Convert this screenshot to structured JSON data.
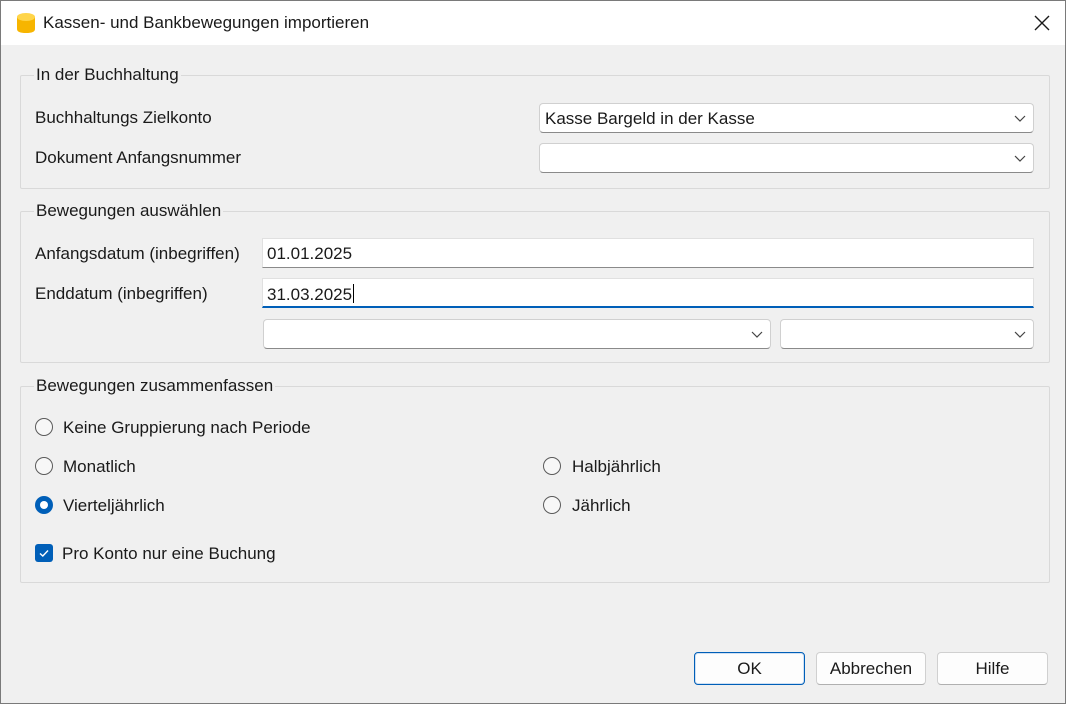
{
  "window": {
    "title": "Kassen- und Bankbewegungen importieren",
    "accent": "#005fb8"
  },
  "icons": {
    "app": "database-icon",
    "close": "close-icon",
    "dropdown": "chevron-down-icon",
    "check": "checkmark-icon"
  },
  "accounting": {
    "group_title": "In der Buchhaltung",
    "target_account_label": "Buchhaltungs Zielkonto",
    "target_account_value": "Kasse Bargeld in der Kasse",
    "doc_start_label": "Dokument Anfangsnummer",
    "doc_start_value": ""
  },
  "select": {
    "group_title": "Bewegungen auswählen",
    "start_label": "Anfangsdatum (inbegriffen)",
    "start_value": "01.01.2025",
    "end_label": "Enddatum (inbegriffen)",
    "end_value": "31.03.2025",
    "period_combo_1": "",
    "period_combo_2": ""
  },
  "summarize": {
    "group_title": "Bewegungen zusammenfassen",
    "options": {
      "none": "Keine Gruppierung nach Periode",
      "monthly": "Monatlich",
      "halfyear": "Halbjährlich",
      "quarterly": "Vierteljährlich",
      "yearly": "Jährlich"
    },
    "selected": "quarterly",
    "one_entry_label": "Pro Konto nur eine Buchung",
    "one_entry_checked": true
  },
  "buttons": {
    "ok": "OK",
    "cancel": "Abbrechen",
    "help": "Hilfe"
  }
}
